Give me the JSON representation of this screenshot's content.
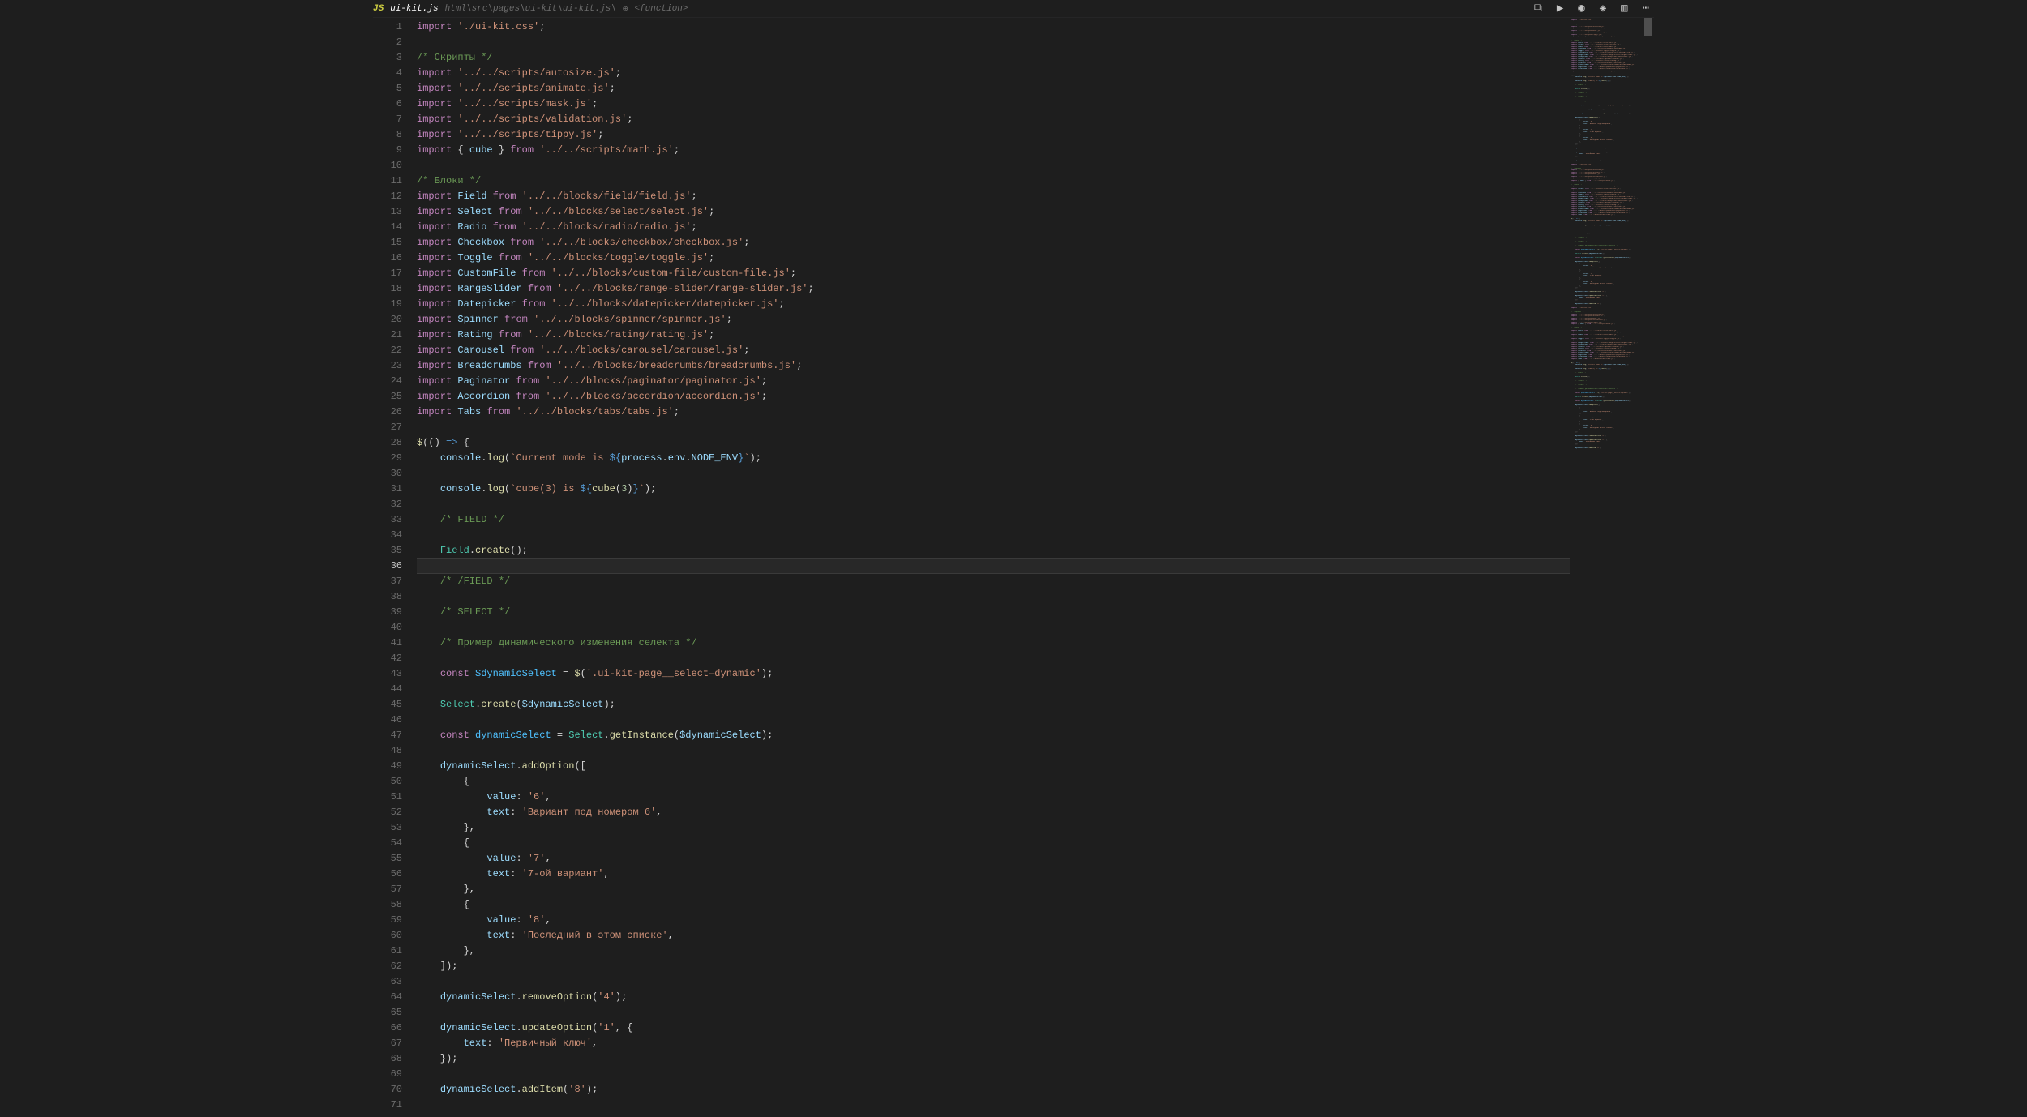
{
  "tab": {
    "icon_label": "JS",
    "filename": "ui-kit.js",
    "path": "html\\src\\pages\\ui-kit\\ui-kit.js\\",
    "breadcrumb_icon": "⊕",
    "breadcrumb_tail": "<function>"
  },
  "toolbar": {
    "compare": "⧉",
    "run": "▶",
    "debug": "◉",
    "split": "◈",
    "layout": "▥",
    "more": "⋯"
  },
  "cursor_line": 36,
  "code": [
    {
      "n": 1,
      "h": "<span class='tk-kw'>import</span> <span class='tk-str'>'./ui-kit.css'</span>;"
    },
    {
      "n": 2,
      "h": ""
    },
    {
      "n": 3,
      "h": "<span class='tk-cmt'>/* Скрипты */</span>"
    },
    {
      "n": 4,
      "h": "<span class='tk-kw'>import</span> <span class='tk-str'>'../../scripts/autosize.js'</span>;"
    },
    {
      "n": 5,
      "h": "<span class='tk-kw'>import</span> <span class='tk-str'>'../../scripts/animate.js'</span>;"
    },
    {
      "n": 6,
      "h": "<span class='tk-kw'>import</span> <span class='tk-str'>'../../scripts/mask.js'</span>;"
    },
    {
      "n": 7,
      "h": "<span class='tk-kw'>import</span> <span class='tk-str'>'../../scripts/validation.js'</span>;"
    },
    {
      "n": 8,
      "h": "<span class='tk-kw'>import</span> <span class='tk-str'>'../../scripts/tippy.js'</span>;"
    },
    {
      "n": 9,
      "h": "<span class='tk-kw'>import</span> { <span class='tk-var'>cube</span> } <span class='tk-kw'>from</span> <span class='tk-str'>'../../scripts/math.js'</span>;"
    },
    {
      "n": 10,
      "h": ""
    },
    {
      "n": 11,
      "h": "<span class='tk-cmt'>/* Блоки */</span>"
    },
    {
      "n": 12,
      "h": "<span class='tk-kw'>import</span> <span class='tk-var'>Field</span> <span class='tk-kw'>from</span> <span class='tk-str'>'../../blocks/field/field.js'</span>;"
    },
    {
      "n": 13,
      "h": "<span class='tk-kw'>import</span> <span class='tk-var'>Select</span> <span class='tk-kw'>from</span> <span class='tk-str'>'../../blocks/select/select.js'</span>;"
    },
    {
      "n": 14,
      "h": "<span class='tk-kw'>import</span> <span class='tk-var'>Radio</span> <span class='tk-kw'>from</span> <span class='tk-str'>'../../blocks/radio/radio.js'</span>;"
    },
    {
      "n": 15,
      "h": "<span class='tk-kw'>import</span> <span class='tk-var'>Checkbox</span> <span class='tk-kw'>from</span> <span class='tk-str'>'../../blocks/checkbox/checkbox.js'</span>;"
    },
    {
      "n": 16,
      "h": "<span class='tk-kw'>import</span> <span class='tk-var'>Toggle</span> <span class='tk-kw'>from</span> <span class='tk-str'>'../../blocks/toggle/toggle.js'</span>;"
    },
    {
      "n": 17,
      "h": "<span class='tk-kw'>import</span> <span class='tk-var'>CustomFile</span> <span class='tk-kw'>from</span> <span class='tk-str'>'../../blocks/custom-file/custom-file.js'</span>;"
    },
    {
      "n": 18,
      "h": "<span class='tk-kw'>import</span> <span class='tk-var'>RangeSlider</span> <span class='tk-kw'>from</span> <span class='tk-str'>'../../blocks/range-slider/range-slider.js'</span>;"
    },
    {
      "n": 19,
      "h": "<span class='tk-kw'>import</span> <span class='tk-var'>Datepicker</span> <span class='tk-kw'>from</span> <span class='tk-str'>'../../blocks/datepicker/datepicker.js'</span>;"
    },
    {
      "n": 20,
      "h": "<span class='tk-kw'>import</span> <span class='tk-var'>Spinner</span> <span class='tk-kw'>from</span> <span class='tk-str'>'../../blocks/spinner/spinner.js'</span>;"
    },
    {
      "n": 21,
      "h": "<span class='tk-kw'>import</span> <span class='tk-var'>Rating</span> <span class='tk-kw'>from</span> <span class='tk-str'>'../../blocks/rating/rating.js'</span>;"
    },
    {
      "n": 22,
      "h": "<span class='tk-kw'>import</span> <span class='tk-var'>Carousel</span> <span class='tk-kw'>from</span> <span class='tk-str'>'../../blocks/carousel/carousel.js'</span>;"
    },
    {
      "n": 23,
      "h": "<span class='tk-kw'>import</span> <span class='tk-var'>Breadcrumbs</span> <span class='tk-kw'>from</span> <span class='tk-str'>'../../blocks/breadcrumbs/breadcrumbs.js'</span>;"
    },
    {
      "n": 24,
      "h": "<span class='tk-kw'>import</span> <span class='tk-var'>Paginator</span> <span class='tk-kw'>from</span> <span class='tk-str'>'../../blocks/paginator/paginator.js'</span>;"
    },
    {
      "n": 25,
      "h": "<span class='tk-kw'>import</span> <span class='tk-var'>Accordion</span> <span class='tk-kw'>from</span> <span class='tk-str'>'../../blocks/accordion/accordion.js'</span>;"
    },
    {
      "n": 26,
      "h": "<span class='tk-kw'>import</span> <span class='tk-var'>Tabs</span> <span class='tk-kw'>from</span> <span class='tk-str'>'../../blocks/tabs/tabs.js'</span>;"
    },
    {
      "n": 27,
      "h": ""
    },
    {
      "n": 28,
      "h": "<span class='tk-fn'>$</span>(() <span class='tk-arrow'>=&gt;</span> {"
    },
    {
      "n": 29,
      "h": "    <span class='tk-var'>console</span>.<span class='tk-fn'>log</span>(<span class='tk-tmpl'>`Current mode is </span><span class='tk-tmpl-expr'>${</span><span class='tk-var'>process</span>.<span class='tk-var'>env</span>.<span class='tk-var'>NODE_ENV</span><span class='tk-tmpl-expr'>}</span><span class='tk-tmpl'>`</span>);"
    },
    {
      "n": 30,
      "h": ""
    },
    {
      "n": 31,
      "h": "    <span class='tk-var'>console</span>.<span class='tk-fn'>log</span>(<span class='tk-tmpl'>`cube(3) is </span><span class='tk-tmpl-expr'>${</span><span class='tk-fn'>cube</span>(<span class='tk-num'>3</span>)<span class='tk-tmpl-expr'>}</span><span class='tk-tmpl'>`</span>);"
    },
    {
      "n": 32,
      "h": ""
    },
    {
      "n": 33,
      "h": "    <span class='tk-cmt'>/* FIELD */</span>"
    },
    {
      "n": 34,
      "h": ""
    },
    {
      "n": 35,
      "h": "    <span class='tk-cls'>Field</span>.<span class='tk-fn'>create</span>();"
    },
    {
      "n": 36,
      "h": ""
    },
    {
      "n": 37,
      "h": "    <span class='tk-cmt'>/* /FIELD */</span>"
    },
    {
      "n": 38,
      "h": ""
    },
    {
      "n": 39,
      "h": "    <span class='tk-cmt'>/* SELECT */</span>"
    },
    {
      "n": 40,
      "h": ""
    },
    {
      "n": 41,
      "h": "    <span class='tk-cmt'>/* Пример динамического изменения селекта */</span>"
    },
    {
      "n": 42,
      "h": ""
    },
    {
      "n": 43,
      "h": "    <span class='tk-kw'>const</span> <span class='tk-obj'>$dynamicSelect</span> = <span class='tk-fn'>$</span>(<span class='tk-str'>'.ui-kit-page__select—dynamic'</span>);"
    },
    {
      "n": 44,
      "h": ""
    },
    {
      "n": 45,
      "h": "    <span class='tk-cls'>Select</span>.<span class='tk-fn'>create</span>(<span class='tk-var'>$dynamicSelect</span>);"
    },
    {
      "n": 46,
      "h": ""
    },
    {
      "n": 47,
      "h": "    <span class='tk-kw'>const</span> <span class='tk-obj'>dynamicSelect</span> = <span class='tk-cls'>Select</span>.<span class='tk-fn'>getInstance</span>(<span class='tk-var'>$dynamicSelect</span>);"
    },
    {
      "n": 48,
      "h": ""
    },
    {
      "n": 49,
      "h": "    <span class='tk-var'>dynamicSelect</span>.<span class='tk-fn'>addOption</span>(["
    },
    {
      "n": 50,
      "h": "        {"
    },
    {
      "n": 51,
      "h": "            <span class='tk-var'>value</span>: <span class='tk-str'>'6'</span>,"
    },
    {
      "n": 52,
      "h": "            <span class='tk-var'>text</span>: <span class='tk-str'>'Вариант под номером 6'</span>,"
    },
    {
      "n": 53,
      "h": "        },"
    },
    {
      "n": 54,
      "h": "        {"
    },
    {
      "n": 55,
      "h": "            <span class='tk-var'>value</span>: <span class='tk-str'>'7'</span>,"
    },
    {
      "n": 56,
      "h": "            <span class='tk-var'>text</span>: <span class='tk-str'>'7-ой вариант'</span>,"
    },
    {
      "n": 57,
      "h": "        },"
    },
    {
      "n": 58,
      "h": "        {"
    },
    {
      "n": 59,
      "h": "            <span class='tk-var'>value</span>: <span class='tk-str'>'8'</span>,"
    },
    {
      "n": 60,
      "h": "            <span class='tk-var'>text</span>: <span class='tk-str'>'Последний в этом списке'</span>,"
    },
    {
      "n": 61,
      "h": "        },"
    },
    {
      "n": 62,
      "h": "    ]);"
    },
    {
      "n": 63,
      "h": ""
    },
    {
      "n": 64,
      "h": "    <span class='tk-var'>dynamicSelect</span>.<span class='tk-fn'>removeOption</span>(<span class='tk-str'>'4'</span>);"
    },
    {
      "n": 65,
      "h": ""
    },
    {
      "n": 66,
      "h": "    <span class='tk-var'>dynamicSelect</span>.<span class='tk-fn'>updateOption</span>(<span class='tk-str'>'1'</span>, {"
    },
    {
      "n": 67,
      "h": "        <span class='tk-var'>text</span>: <span class='tk-str'>'Первичный ключ'</span>,"
    },
    {
      "n": 68,
      "h": "    });"
    },
    {
      "n": 69,
      "h": ""
    },
    {
      "n": 70,
      "h": "    <span class='tk-var'>dynamicSelect</span>.<span class='tk-fn'>addItem</span>(<span class='tk-str'>'8'</span>);"
    },
    {
      "n": 71,
      "h": ""
    }
  ]
}
